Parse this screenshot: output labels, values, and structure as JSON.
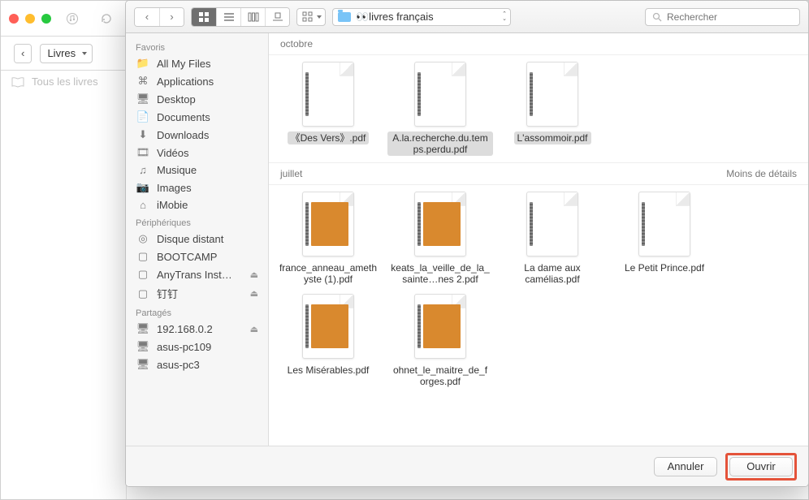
{
  "background": {
    "library_label": "Livres",
    "side_item": "Tous les livres"
  },
  "dialog": {
    "path_label": "👀livres français",
    "search_placeholder": "Rechercher",
    "details_toggle": "Moins de détails",
    "buttons": {
      "cancel": "Annuler",
      "open": "Ouvrir"
    }
  },
  "sidebar": {
    "favorites_header": "Favoris",
    "favorites": [
      {
        "icon": "📁",
        "label": "All My Files"
      },
      {
        "icon": "⌘",
        "label": "Applications"
      },
      {
        "icon": "🖥",
        "label": "Desktop"
      },
      {
        "icon": "📄",
        "label": "Documents"
      },
      {
        "icon": "⬇",
        "label": "Downloads"
      },
      {
        "icon": "🎞",
        "label": "Vidéos"
      },
      {
        "icon": "♫",
        "label": "Musique"
      },
      {
        "icon": "📷",
        "label": "Images"
      },
      {
        "icon": "⌂",
        "label": "iMobie"
      }
    ],
    "devices_header": "Périphériques",
    "devices": [
      {
        "icon": "◎",
        "label": "Disque distant",
        "eject": false
      },
      {
        "icon": "▢",
        "label": "BOOTCAMP",
        "eject": false
      },
      {
        "icon": "▢",
        "label": "AnyTrans Inst…",
        "eject": true
      },
      {
        "icon": "▢",
        "label": "钉钉",
        "eject": true
      }
    ],
    "shared_header": "Partagés",
    "shared": [
      {
        "icon": "🖥",
        "label": "192.168.0.2",
        "eject": true
      },
      {
        "icon": "🖥",
        "label": "asus-pc109"
      },
      {
        "icon": "🖥",
        "label": "asus-pc3"
      }
    ]
  },
  "sections": [
    {
      "title": "octobre",
      "files": [
        {
          "name": "《Des Vers》.pdf",
          "selected": true,
          "tone": "plain"
        },
        {
          "name": "A.la.recherche.du.temps.perdu.pdf",
          "selected": true,
          "tone": "plain"
        },
        {
          "name": "L'assommoir.pdf",
          "selected": true,
          "tone": "plain"
        }
      ]
    },
    {
      "title": "juillet",
      "files": [
        {
          "name": "france_anneau_amethyste (1).pdf",
          "tone": "orange"
        },
        {
          "name": "keats_la_veille_de_la_sainte…nes 2.pdf",
          "tone": "orange"
        },
        {
          "name": "La dame aux camélias.pdf",
          "tone": "plain"
        },
        {
          "name": "Le Petit Prince.pdf",
          "tone": "plain"
        },
        {
          "name": "Les Misérables.pdf",
          "tone": "orange"
        },
        {
          "name": "ohnet_le_maitre_de_forges.pdf",
          "tone": "orange"
        }
      ]
    }
  ]
}
